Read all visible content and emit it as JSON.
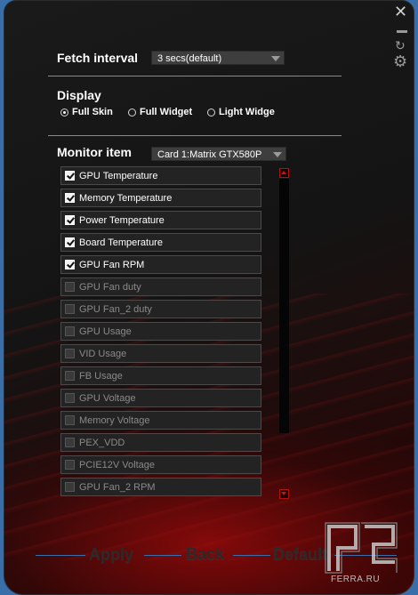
{
  "window_controls": {
    "close": "✕",
    "sync": "↻",
    "gear": "⚙"
  },
  "fetch": {
    "label": "Fetch interval",
    "value": "3 secs(default)"
  },
  "display": {
    "label": "Display",
    "options": [
      {
        "label": "Full Skin",
        "selected": true
      },
      {
        "label": "Full Widget",
        "selected": false
      },
      {
        "label": "Light Widge",
        "selected": false
      }
    ]
  },
  "monitor": {
    "label": "Monitor item",
    "card": "Card 1:Matrix GTX580P",
    "items": [
      {
        "label": "GPU Temperature",
        "checked": true
      },
      {
        "label": "Memory Temperature",
        "checked": true
      },
      {
        "label": "Power Temperature",
        "checked": true
      },
      {
        "label": "Board Temperature",
        "checked": true
      },
      {
        "label": "GPU Fan RPM",
        "checked": true
      },
      {
        "label": "GPU Fan duty",
        "checked": false
      },
      {
        "label": "GPU Fan_2 duty",
        "checked": false
      },
      {
        "label": "GPU Usage",
        "checked": false
      },
      {
        "label": "VID Usage",
        "checked": false
      },
      {
        "label": "FB Usage",
        "checked": false
      },
      {
        "label": "GPU Voltage",
        "checked": false
      },
      {
        "label": "Memory Voltage",
        "checked": false
      },
      {
        "label": "PEX_VDD",
        "checked": false
      },
      {
        "label": "PCIE12V Voltage",
        "checked": false
      },
      {
        "label": "GPU Fan_2 RPM",
        "checked": false
      }
    ]
  },
  "buttons": {
    "apply": "Apply",
    "back": "Back",
    "default": "Default"
  },
  "watermark": {
    "text": "FERRA.RU"
  },
  "colors": {
    "accent": "#c81010",
    "line": "#3a6ea8"
  }
}
